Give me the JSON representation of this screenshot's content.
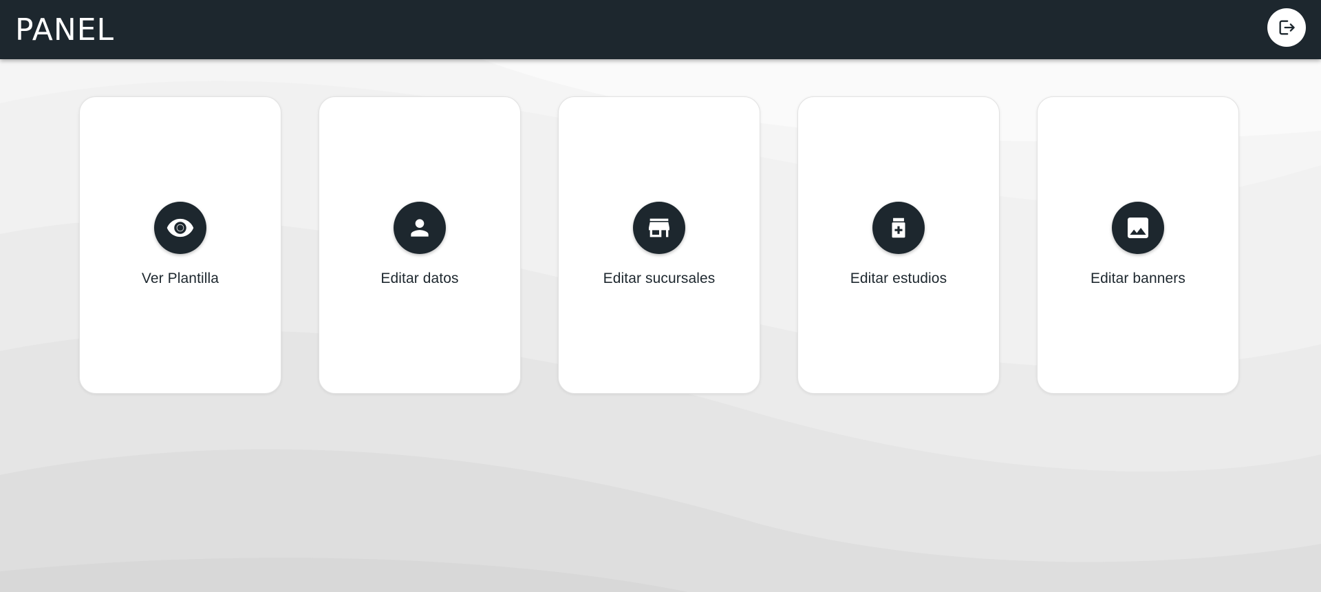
{
  "header": {
    "title": "PANEL",
    "logout_icon": "logout-icon"
  },
  "cards": [
    {
      "label": "Ver Plantilla",
      "icon": "eye-icon"
    },
    {
      "label": "Editar datos",
      "icon": "person-icon"
    },
    {
      "label": "Editar sucursales",
      "icon": "store-icon"
    },
    {
      "label": "Editar estudios",
      "icon": "medication-icon"
    },
    {
      "label": "Editar banners",
      "icon": "image-icon"
    }
  ],
  "colors": {
    "header_bg": "#1d272e",
    "icon_bg": "#1d272e",
    "card_bg": "#ffffff",
    "page_bg": "#f4f4f4"
  }
}
